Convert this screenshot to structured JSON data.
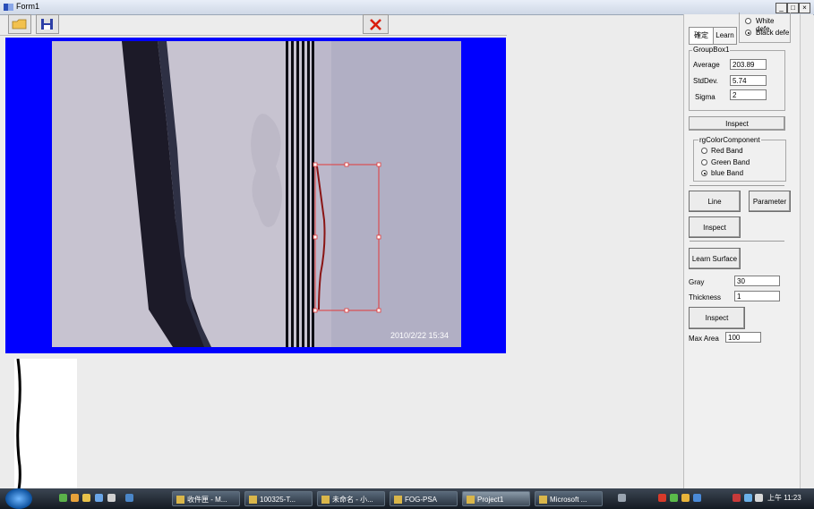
{
  "window": {
    "title": "Form1"
  },
  "photo": {
    "timestamp": "2010/2/22 15:34"
  },
  "tabs": [
    {
      "label": "確定"
    },
    {
      "label": "Learn"
    }
  ],
  "defect_options": [
    {
      "label": "White defe",
      "selected": false
    },
    {
      "label": "Black defe",
      "selected": true
    }
  ],
  "groupbox1": {
    "title": "GroupBox1",
    "rows": [
      {
        "label": "Average",
        "value": "203.89"
      },
      {
        "label": "StdDev.",
        "value": "5.74"
      },
      {
        "label": "Sigma",
        "value": "2"
      }
    ]
  },
  "inspect_top": "Inspect",
  "color_component": {
    "title": "rgColorComponent",
    "options": [
      {
        "label": "Red Band",
        "selected": false
      },
      {
        "label": "Green Band",
        "selected": false
      },
      {
        "label": "blue Band",
        "selected": true
      }
    ]
  },
  "buttons": {
    "line": "Line",
    "parameter": "Parameter",
    "inspect_mid": "Inspect",
    "learn_surface": "Learn Surface",
    "inspect_bottom": "Inspect"
  },
  "fields": {
    "gray": {
      "label": "Gray",
      "value": "30"
    },
    "thickness": {
      "label": "Thickness",
      "value": "1"
    },
    "max_area": {
      "label": "Max Area",
      "value": "100"
    }
  },
  "taskbar": {
    "items": [
      {
        "label": "收件匣 - M..."
      },
      {
        "label": "100325-T..."
      },
      {
        "label": "未命名 - 小..."
      },
      {
        "label": "FOG-PSA"
      },
      {
        "label": "Project1"
      },
      {
        "label": "Microsoft ..."
      }
    ],
    "clock": "上午 11:23"
  }
}
